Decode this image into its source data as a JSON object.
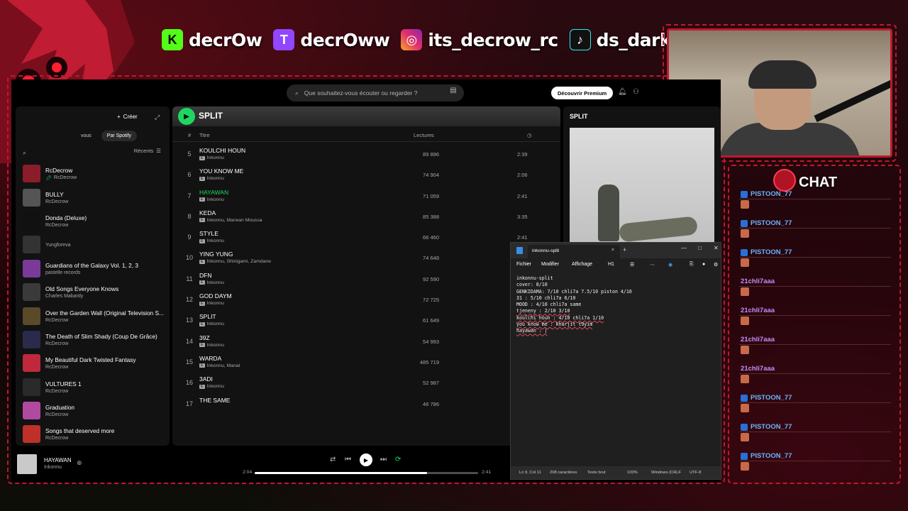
{
  "socials": [
    {
      "icon": "kick-icon",
      "letter": "K",
      "color": "#53fc18",
      "text_color": "#000",
      "handle": "decrOw"
    },
    {
      "icon": "twitch-icon",
      "letter": "T",
      "color": "#9146ff",
      "text_color": "#fff",
      "handle": "decrOww"
    },
    {
      "icon": "instagram-icon",
      "letter": "◎",
      "color": "#e1306c",
      "text_color": "#fff",
      "handle": "its_decrow_rc"
    },
    {
      "icon": "tiktok-icon",
      "letter": "♪",
      "color": "#111111",
      "text_color": "#fff",
      "handle": "ds_darksync"
    }
  ],
  "chat": {
    "title": "CHAT",
    "messages": [
      {
        "user": "PISTOON_77",
        "color": "#6ab4ff",
        "badge": true
      },
      {
        "user": "PISTOON_77",
        "color": "#6ab4ff",
        "badge": true
      },
      {
        "user": "PISTOON_77",
        "color": "#6ab4ff",
        "badge": true
      },
      {
        "user": "21chli7aaa",
        "color": "#c88cff",
        "badge": false
      },
      {
        "user": "21chli7aaa",
        "color": "#c88cff",
        "badge": false
      },
      {
        "user": "21chli7aaa",
        "color": "#c88cff",
        "badge": false
      },
      {
        "user": "21chli7aaa",
        "color": "#c88cff",
        "badge": false
      },
      {
        "user": "PISTOON_77",
        "color": "#6ab4ff",
        "badge": true
      },
      {
        "user": "PISTOON_77",
        "color": "#6ab4ff",
        "badge": true
      },
      {
        "user": "PISTOON_77",
        "color": "#6ab4ff",
        "badge": true
      }
    ]
  },
  "spotify": {
    "search_placeholder": "Que souhaitez-vous écouter ou regarder ?",
    "discover_button": "Découvrir Premium",
    "library": {
      "create_label": "Créer",
      "chip_you": "vous",
      "chip_spotify": "Par Spotify",
      "sort_label": "Récents",
      "items": [
        {
          "title": "RcDecrow",
          "sub": "RcDecrow",
          "pinned": true,
          "color": "#8b1c2a"
        },
        {
          "title": "BULLY",
          "sub": "RcDecrow",
          "pinned": false,
          "color": "#555555"
        },
        {
          "title": "Donda (Deluxe)",
          "sub": "RcDecrow",
          "pinned": false,
          "color": "#111111"
        },
        {
          "title": "",
          "sub": "Yungforeva",
          "pinned": false,
          "color": "#333333"
        },
        {
          "title": "Guardians of the Galaxy Vol. 1, 2, 3",
          "sub": "pastelle records",
          "pinned": false,
          "color": "#7a3a9a"
        },
        {
          "title": "Old Songs Everyone Knows",
          "sub": "Charles Mabardy",
          "pinned": false,
          "color": "#3a3a3a"
        },
        {
          "title": "Over the Garden Wall (Original Television S...",
          "sub": "RcDecrow",
          "pinned": false,
          "color": "#5a4a2a"
        },
        {
          "title": "The Death of Slim Shady (Coup De Grâce)",
          "sub": "RcDecrow",
          "pinned": false,
          "color": "#2a2a4a"
        },
        {
          "title": "My Beautiful Dark Twisted Fantasy",
          "sub": "RcDecrow",
          "pinned": false,
          "color": "#c0283c"
        },
        {
          "title": "VULTURES 1",
          "sub": "RcDecrow",
          "pinned": false,
          "color": "#2a2a2a"
        },
        {
          "title": "Graduation",
          "sub": "RcDecrow",
          "pinned": false,
          "color": "#b04aa0"
        },
        {
          "title": "Songs that deserved more",
          "sub": "RcDecrow",
          "pinned": false,
          "color": "#c0302a"
        }
      ]
    },
    "main": {
      "title": "SPLIT",
      "col_num": "#",
      "col_title": "Titre",
      "col_plays": "Lectures",
      "tracks": [
        {
          "num": "5",
          "title": "KOULCHI HOUN",
          "artist": "Inkonnu",
          "plays": "89 896",
          "duration": "2:39",
          "active": false
        },
        {
          "num": "6",
          "title": "YOU KNOW ME",
          "artist": "Inkonnu",
          "plays": "74 904",
          "duration": "2:06",
          "active": false
        },
        {
          "num": "7",
          "title": "HAYAWAN",
          "artist": "Inkonnu",
          "plays": "71 059",
          "duration": "2:41",
          "active": true
        },
        {
          "num": "8",
          "title": "KEDA",
          "artist": "Inkonnu, Marwan Moussa",
          "plays": "85 388",
          "duration": "3:35",
          "active": false
        },
        {
          "num": "9",
          "title": "STYLE",
          "artist": "Inkonnu",
          "plays": "66 460",
          "duration": "2:41",
          "active": false
        },
        {
          "num": "10",
          "title": "YING YUNG",
          "artist": "Inkonnu, Shinigami, Zamdane",
          "plays": "74 648",
          "duration": "",
          "active": false
        },
        {
          "num": "11",
          "title": "DFN",
          "artist": "Inkonnu",
          "plays": "92 590",
          "duration": "",
          "active": false
        },
        {
          "num": "12",
          "title": "GOD DAYM",
          "artist": "Inkonnu",
          "plays": "72 725",
          "duration": "",
          "active": false
        },
        {
          "num": "13",
          "title": "SPLIT",
          "artist": "Inkonnu",
          "plays": "61 649",
          "duration": "",
          "active": false
        },
        {
          "num": "14",
          "title": "39Z",
          "artist": "Inkonnu",
          "plays": "54 993",
          "duration": "",
          "active": false
        },
        {
          "num": "15",
          "title": "WARDA",
          "artist": "Inkonnu, Manal",
          "plays": "485 719",
          "duration": "",
          "active": false
        },
        {
          "num": "16",
          "title": "3ADI",
          "artist": "Inkonnu",
          "plays": "52 987",
          "duration": "",
          "active": false
        },
        {
          "num": "17",
          "title": "THE SAME",
          "artist": "",
          "plays": "46 786",
          "duration": "",
          "active": false
        }
      ]
    },
    "right_panel": {
      "title": "SPLIT"
    },
    "player": {
      "title": "HAYAWAN",
      "artist": "Inkonnu",
      "elapsed": "2:04",
      "total": "2:41",
      "progress": 0.77
    }
  },
  "notepad": {
    "tab_title": "inkonnu-split",
    "menu": [
      "Fichier",
      "Modifier",
      "Affichage"
    ],
    "heading_btn": "H1",
    "lines": [
      "inkonnu-split",
      "cover: 8/10",
      "GENKIDAMA: 7/10 chli7a 7.5/10 piston 4/10",
      "31 : 5/10 chli7a 6/10",
      "MOOD : 4/10 chli7a same",
      "tjeneny : 2/10 3/10",
      "koulchi houn : 4/10 chli7a 1/10",
      "you know me : kharjit t9yim",
      "hayawan : |"
    ],
    "status": {
      "position": "Ln 9, Col 11",
      "chars": "208 caractères",
      "format": "Texte brut",
      "zoom": "100%",
      "eol": "Windows (CRLF",
      "encoding": "UTF-8"
    }
  }
}
